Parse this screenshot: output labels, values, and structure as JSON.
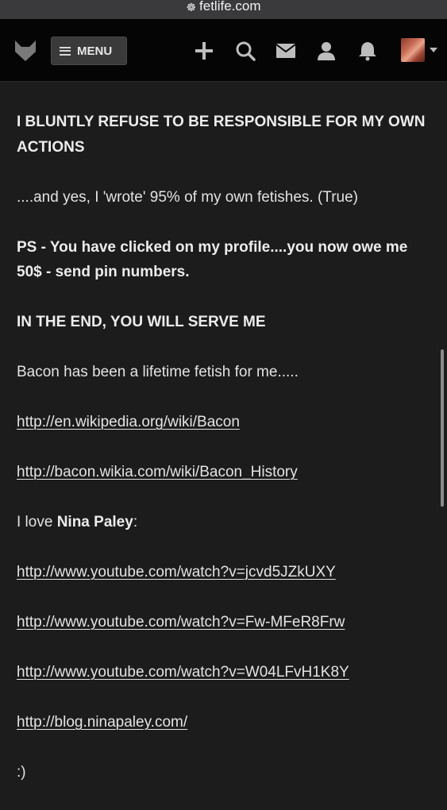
{
  "browser": {
    "url": "fetlife.com"
  },
  "nav": {
    "menu_label": "MENU",
    "icons": [
      "fox-logo-icon",
      "plus-icon",
      "search-icon",
      "mail-icon",
      "user-icon",
      "bell-icon",
      "avatar",
      "caret-down-icon"
    ]
  },
  "profile": {
    "p1": "I BLUNTLY REFUSE TO BE RESPONSIBLE FOR MY OWN ACTIONS",
    "p2": "....and yes, I 'wrote' 95% of my own fetishes. (True)",
    "p3": "PS - You have clicked on my profile....you now owe me 50$ - send pin numbers.",
    "p4": "IN THE END, YOU WILL SERVE ME",
    "p5": "Bacon has been a lifetime fetish for me.....",
    "links": [
      "http://en.wikipedia.org/wiki/Bacon",
      "http://bacon.wikia.com/wiki/Bacon_History"
    ],
    "love_prefix": "I love ",
    "love_name": "Nina Paley",
    "love_suffix": ":",
    "paley_links": [
      "http://www.youtube.com/watch?v=jcvd5JZkUXY",
      "http://www.youtube.com/watch?v=Fw-MFeR8Frw",
      "http://www.youtube.com/watch?v=W04LFvH1K8Y",
      "http://blog.ninapaley.com/"
    ],
    "closing": ":)"
  }
}
